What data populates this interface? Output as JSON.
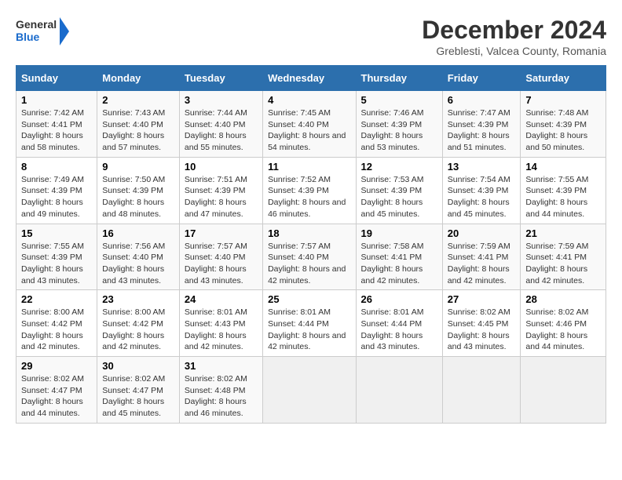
{
  "logo": {
    "line1": "General",
    "line2": "Blue"
  },
  "title": "December 2024",
  "location": "Greblesti, Valcea County, Romania",
  "days_of_week": [
    "Sunday",
    "Monday",
    "Tuesday",
    "Wednesday",
    "Thursday",
    "Friday",
    "Saturday"
  ],
  "weeks": [
    [
      {
        "day": 1,
        "sunrise": "7:42 AM",
        "sunset": "4:41 PM",
        "daylight": "8 hours and 58 minutes."
      },
      {
        "day": 2,
        "sunrise": "7:43 AM",
        "sunset": "4:40 PM",
        "daylight": "8 hours and 57 minutes."
      },
      {
        "day": 3,
        "sunrise": "7:44 AM",
        "sunset": "4:40 PM",
        "daylight": "8 hours and 55 minutes."
      },
      {
        "day": 4,
        "sunrise": "7:45 AM",
        "sunset": "4:40 PM",
        "daylight": "8 hours and 54 minutes."
      },
      {
        "day": 5,
        "sunrise": "7:46 AM",
        "sunset": "4:39 PM",
        "daylight": "8 hours and 53 minutes."
      },
      {
        "day": 6,
        "sunrise": "7:47 AM",
        "sunset": "4:39 PM",
        "daylight": "8 hours and 51 minutes."
      },
      {
        "day": 7,
        "sunrise": "7:48 AM",
        "sunset": "4:39 PM",
        "daylight": "8 hours and 50 minutes."
      }
    ],
    [
      {
        "day": 8,
        "sunrise": "7:49 AM",
        "sunset": "4:39 PM",
        "daylight": "8 hours and 49 minutes."
      },
      {
        "day": 9,
        "sunrise": "7:50 AM",
        "sunset": "4:39 PM",
        "daylight": "8 hours and 48 minutes."
      },
      {
        "day": 10,
        "sunrise": "7:51 AM",
        "sunset": "4:39 PM",
        "daylight": "8 hours and 47 minutes."
      },
      {
        "day": 11,
        "sunrise": "7:52 AM",
        "sunset": "4:39 PM",
        "daylight": "8 hours and 46 minutes."
      },
      {
        "day": 12,
        "sunrise": "7:53 AM",
        "sunset": "4:39 PM",
        "daylight": "8 hours and 45 minutes."
      },
      {
        "day": 13,
        "sunrise": "7:54 AM",
        "sunset": "4:39 PM",
        "daylight": "8 hours and 45 minutes."
      },
      {
        "day": 14,
        "sunrise": "7:55 AM",
        "sunset": "4:39 PM",
        "daylight": "8 hours and 44 minutes."
      }
    ],
    [
      {
        "day": 15,
        "sunrise": "7:55 AM",
        "sunset": "4:39 PM",
        "daylight": "8 hours and 43 minutes."
      },
      {
        "day": 16,
        "sunrise": "7:56 AM",
        "sunset": "4:40 PM",
        "daylight": "8 hours and 43 minutes."
      },
      {
        "day": 17,
        "sunrise": "7:57 AM",
        "sunset": "4:40 PM",
        "daylight": "8 hours and 43 minutes."
      },
      {
        "day": 18,
        "sunrise": "7:57 AM",
        "sunset": "4:40 PM",
        "daylight": "8 hours and 42 minutes."
      },
      {
        "day": 19,
        "sunrise": "7:58 AM",
        "sunset": "4:41 PM",
        "daylight": "8 hours and 42 minutes."
      },
      {
        "day": 20,
        "sunrise": "7:59 AM",
        "sunset": "4:41 PM",
        "daylight": "8 hours and 42 minutes."
      },
      {
        "day": 21,
        "sunrise": "7:59 AM",
        "sunset": "4:41 PM",
        "daylight": "8 hours and 42 minutes."
      }
    ],
    [
      {
        "day": 22,
        "sunrise": "8:00 AM",
        "sunset": "4:42 PM",
        "daylight": "8 hours and 42 minutes."
      },
      {
        "day": 23,
        "sunrise": "8:00 AM",
        "sunset": "4:42 PM",
        "daylight": "8 hours and 42 minutes."
      },
      {
        "day": 24,
        "sunrise": "8:01 AM",
        "sunset": "4:43 PM",
        "daylight": "8 hours and 42 minutes."
      },
      {
        "day": 25,
        "sunrise": "8:01 AM",
        "sunset": "4:44 PM",
        "daylight": "8 hours and 42 minutes."
      },
      {
        "day": 26,
        "sunrise": "8:01 AM",
        "sunset": "4:44 PM",
        "daylight": "8 hours and 43 minutes."
      },
      {
        "day": 27,
        "sunrise": "8:02 AM",
        "sunset": "4:45 PM",
        "daylight": "8 hours and 43 minutes."
      },
      {
        "day": 28,
        "sunrise": "8:02 AM",
        "sunset": "4:46 PM",
        "daylight": "8 hours and 44 minutes."
      }
    ],
    [
      {
        "day": 29,
        "sunrise": "8:02 AM",
        "sunset": "4:47 PM",
        "daylight": "8 hours and 44 minutes."
      },
      {
        "day": 30,
        "sunrise": "8:02 AM",
        "sunset": "4:47 PM",
        "daylight": "8 hours and 45 minutes."
      },
      {
        "day": 31,
        "sunrise": "8:02 AM",
        "sunset": "4:48 PM",
        "daylight": "8 hours and 46 minutes."
      },
      null,
      null,
      null,
      null
    ]
  ],
  "labels": {
    "sunrise": "Sunrise:",
    "sunset": "Sunset:",
    "daylight": "Daylight:"
  }
}
